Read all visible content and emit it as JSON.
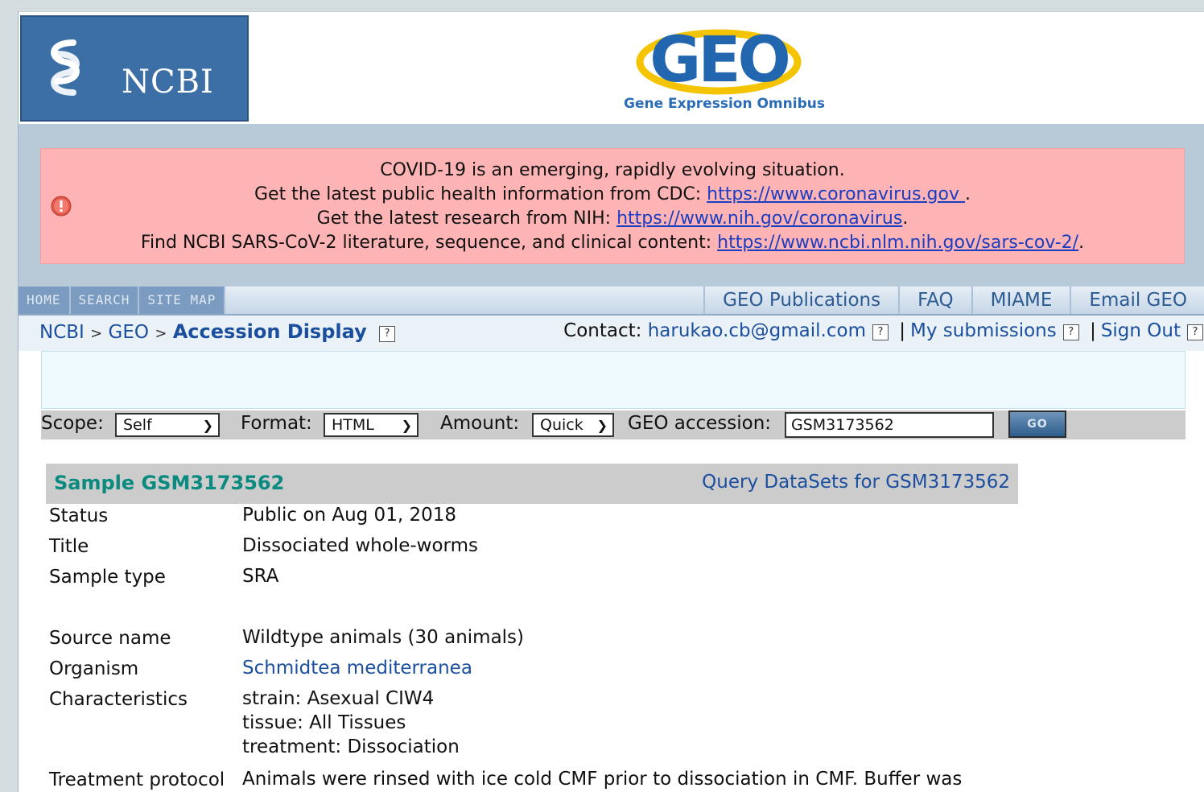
{
  "header": {
    "ncbi_logo": "NCBI",
    "geo_logo": "GEO",
    "geo_subtitle": "Gene Expression Omnibus"
  },
  "covid": {
    "line1": "COVID-19 is an emerging, rapidly evolving situation.",
    "line2_prefix": "Get the latest public health information from CDC: ",
    "line2_link": "https://www.coronavirus.gov ",
    "line2_suffix": ".",
    "line3_prefix": "Get the latest research from NIH: ",
    "line3_link": "https://www.nih.gov/coronavirus",
    "line3_suffix": ".",
    "line4_prefix": "Find NCBI SARS-CoV-2 literature, sequence, and clinical content: ",
    "line4_link": "https://www.ncbi.nlm.nih.gov/sars-cov-2/",
    "line4_suffix": "."
  },
  "nav": {
    "left": [
      "HOME",
      "SEARCH",
      "SITE MAP"
    ],
    "right": [
      "GEO Publications",
      "FAQ",
      "MIAME",
      "Email GEO"
    ]
  },
  "breadcrumb": {
    "ncbi": "NCBI",
    "sep": ">",
    "geo": "GEO",
    "current": "Accession Display",
    "help": "?"
  },
  "account": {
    "contact_label": "Contact: ",
    "contact_email": "harukao.cb@gmail.com",
    "help": "?",
    "bar": "|",
    "my_submissions": "My submissions",
    "sign_out": "Sign Out"
  },
  "scope_bar": {
    "scope_label": "Scope:",
    "scope_value": "Self",
    "format_label": "Format:",
    "format_value": "HTML",
    "amount_label": "Amount:",
    "amount_value": "Quick",
    "accession_label": "GEO accession:",
    "accession_value": "GSM3173562",
    "go_label": "GO"
  },
  "sample": {
    "title": "Sample GSM3173562",
    "query_link": "Query DataSets for GSM3173562",
    "status_k": "Status",
    "status_v": "Public on Aug 01, 2018",
    "title_k": "Title",
    "title_v": "Dissociated whole-worms",
    "type_k": "Sample type",
    "type_v": "SRA",
    "source_k": "Source name",
    "source_v": "Wildtype animals (30 animals)",
    "organism_k": "Organism",
    "organism_v": "Schmidtea mediterranea",
    "char_k": "Characteristics",
    "char_1": "strain: Asexual CIW4",
    "char_2": "tissue: All Tissues",
    "char_3": "treatment: Dissociation",
    "treat_k": "Treatment protocol",
    "treat_v": "Animals were rinsed with ice cold CMF prior to dissociation in CMF. Buffer was"
  }
}
